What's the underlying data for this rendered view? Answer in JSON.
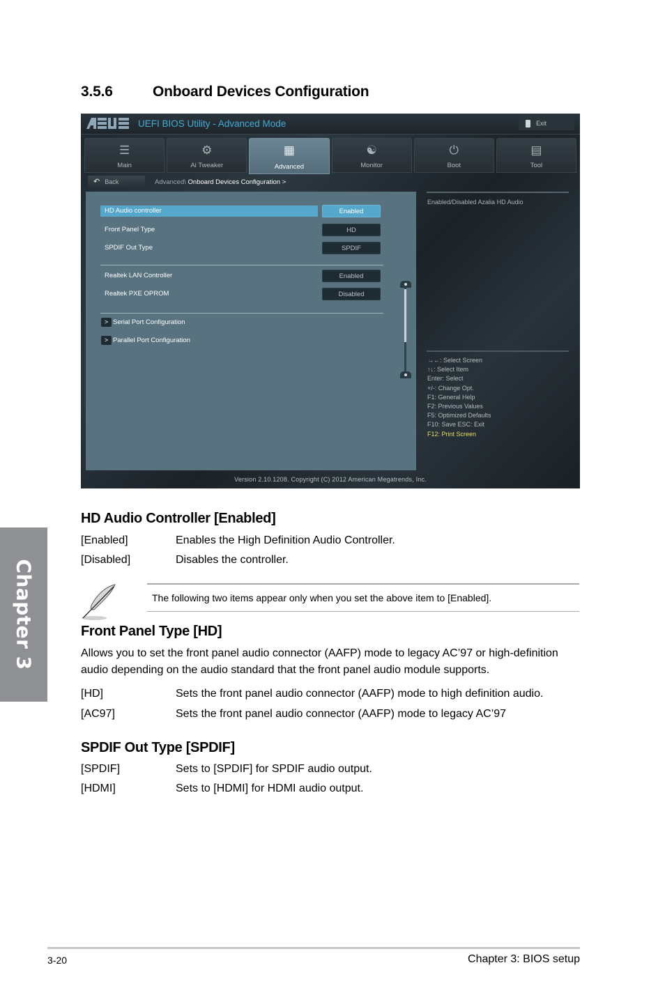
{
  "section": {
    "number": "3.5.6",
    "title": "Onboard Devices Configuration"
  },
  "bios": {
    "logo": "/ISUS",
    "title": "UEFI BIOS Utility - Advanced Mode",
    "exit_label": "Exit",
    "tabs": [
      {
        "label": "Main",
        "icon": "list-icon",
        "active": false
      },
      {
        "label": "Ai  Tweaker",
        "icon": "tweaker-icon",
        "active": false
      },
      {
        "label": "Advanced",
        "icon": "advanced-icon",
        "active": true
      },
      {
        "label": "Monitor",
        "icon": "monitor-icon",
        "active": false
      },
      {
        "label": "Boot",
        "icon": "power-icon",
        "active": false
      },
      {
        "label": "Tool",
        "icon": "tool-icon",
        "active": false
      }
    ],
    "back_label": "Back",
    "breadcrumb": {
      "parent": "Advanced\\",
      "current": "Onboard Devices Configuration  >"
    },
    "items": [
      {
        "label": "HD Audio controller",
        "value": "Enabled",
        "selected": true
      },
      {
        "label": "Front Panel Type",
        "value": "HD"
      },
      {
        "label": "SPDIF Out Type",
        "value": "SPDIF"
      },
      {
        "label": "Realtek LAN Controller",
        "value": "Enabled"
      },
      {
        "label": "Realtek PXE OPROM",
        "value": "Disabled"
      }
    ],
    "submenus": [
      {
        "arrow": ">",
        "label": "Serial Port Configuration"
      },
      {
        "arrow": ">",
        "label": "Parallel Port Configuration"
      }
    ],
    "help_text": "Enabled/Disabled Azalia HD Audio",
    "keys": [
      "→←:  Select Screen",
      "↑↓:  Select Item",
      "Enter:  Select",
      "+/-:  Change Opt.",
      "F1:  General Help",
      "F2:  Previous Values",
      "F5:  Optimized Defaults",
      "F10:  Save    ESC:  Exit",
      "F12: Print Screen"
    ],
    "footer": "Version  2.10.1208.  Copyright  (C)  2012  American  Megatrends,  Inc."
  },
  "hd_audio": {
    "heading": "HD Audio Controller [Enabled]",
    "options": [
      {
        "key": "[Enabled]",
        "desc": "Enables the High Definition Audio Controller."
      },
      {
        "key": "[Disabled]",
        "desc": "Disables the controller."
      }
    ]
  },
  "note": {
    "text": "The following two items appear only when you set the above item to [Enabled]."
  },
  "front_panel": {
    "heading": "Front Panel Type [HD]",
    "description": "Allows you to set the front panel audio connector (AAFP) mode to legacy AC’97 or high-definition audio depending on the audio standard that the front panel audio module supports.",
    "options": [
      {
        "key": "[HD]",
        "desc": "Sets the front panel audio connector (AAFP) mode to high definition audio."
      },
      {
        "key": "[AC97]",
        "desc": "Sets the front panel audio connector (AAFP) mode to legacy AC’97"
      }
    ]
  },
  "spdif": {
    "heading": "SPDIF Out Type [SPDIF]",
    "options": [
      {
        "key": "[SPDIF]",
        "desc": "Sets to [SPDIF] for SPDIF audio output."
      },
      {
        "key": "[HDMI]",
        "desc": "Sets to [HDMI] for HDMI audio output."
      }
    ]
  },
  "chapter_tab": "Chapter 3",
  "footer": {
    "page": "3-20",
    "chapter": "Chapter 3: BIOS setup"
  }
}
